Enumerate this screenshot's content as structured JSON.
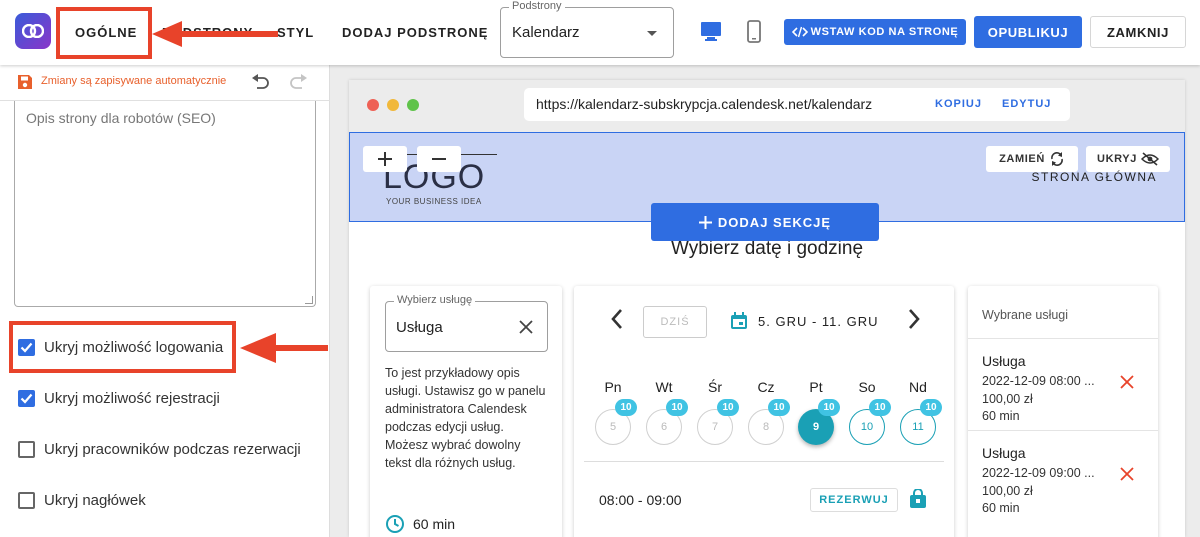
{
  "topbar": {
    "tabs": [
      "OGÓLNE",
      "PODSTRONY",
      "STYL",
      "DODAJ PODSTRONĘ"
    ],
    "subpage_select": {
      "label": "Podstrony",
      "value": "Kalendarz"
    },
    "embed_button": "WSTAW KOD NA STRONĘ",
    "publish_button": "OPUBLIKUJ",
    "close_button": "ZAMKNIJ",
    "accent": "#2f6de1",
    "annotation_color": "#e8432a"
  },
  "left": {
    "autosave": "Zmiany są zapisywane automatycznie",
    "seo_placeholder": "Opis strony dla robotów (SEO)",
    "checks": [
      {
        "label": "Ukryj możliwość logowania",
        "checked": true
      },
      {
        "label": "Ukryj możliwość rejestracji",
        "checked": true
      },
      {
        "label": "Ukryj pracowników podczas rezerwacji",
        "checked": false
      },
      {
        "label": "Ukryj nagłówek",
        "checked": false
      }
    ]
  },
  "preview": {
    "url": "https://kalendarz-subskrypcja.calendesk.net/kalendarz",
    "copy_link": "KOPIUJ",
    "edit_link": "EDYTUJ",
    "logo": "LOGO",
    "logo_sub": "YOUR BUSINESS IDEA",
    "replace_button": "ZAMIEŃ",
    "hide_button": "UKRYJ",
    "home_label": "STRONA GŁÓWNA",
    "add_section": "DODAJ SEKCJĘ",
    "section_title": "Wybierz datę i godzinę",
    "service": {
      "label": "Wybierz usługę",
      "value": "Usługa",
      "description": "To jest przykładowy opis usługi. Ustawisz go w panelu administratora Calendesk podczas edycji usług. Możesz wybrać dowolny tekst dla różnych usług.",
      "duration": "60 min"
    },
    "calendar": {
      "today": "DZIŚ",
      "range": "5. GRU - 11. GRU",
      "days": [
        {
          "name": "Pn",
          "num": "5",
          "badge": "10",
          "state": "past"
        },
        {
          "name": "Wt",
          "num": "6",
          "badge": "10",
          "state": "past"
        },
        {
          "name": "Śr",
          "num": "7",
          "badge": "10",
          "state": "past"
        },
        {
          "name": "Cz",
          "num": "8",
          "badge": "10",
          "state": "past"
        },
        {
          "name": "Pt",
          "num": "9",
          "badge": "10",
          "state": "selected"
        },
        {
          "name": "So",
          "num": "10",
          "badge": "10",
          "state": "available"
        },
        {
          "name": "Nd",
          "num": "11",
          "badge": "10",
          "state": "available"
        }
      ],
      "slot_time": "08:00 - 09:00",
      "reserve": "REZERWUJ"
    },
    "selected": {
      "title": "Wybrane usługi",
      "items": [
        {
          "name": "Usługa",
          "datetime": "2022-12-09 08:00 ...",
          "price": "100,00 zł",
          "duration": "60 min"
        },
        {
          "name": "Usługa",
          "datetime": "2022-12-09 09:00 ...",
          "price": "100,00 zł",
          "duration": "60 min"
        }
      ]
    }
  }
}
